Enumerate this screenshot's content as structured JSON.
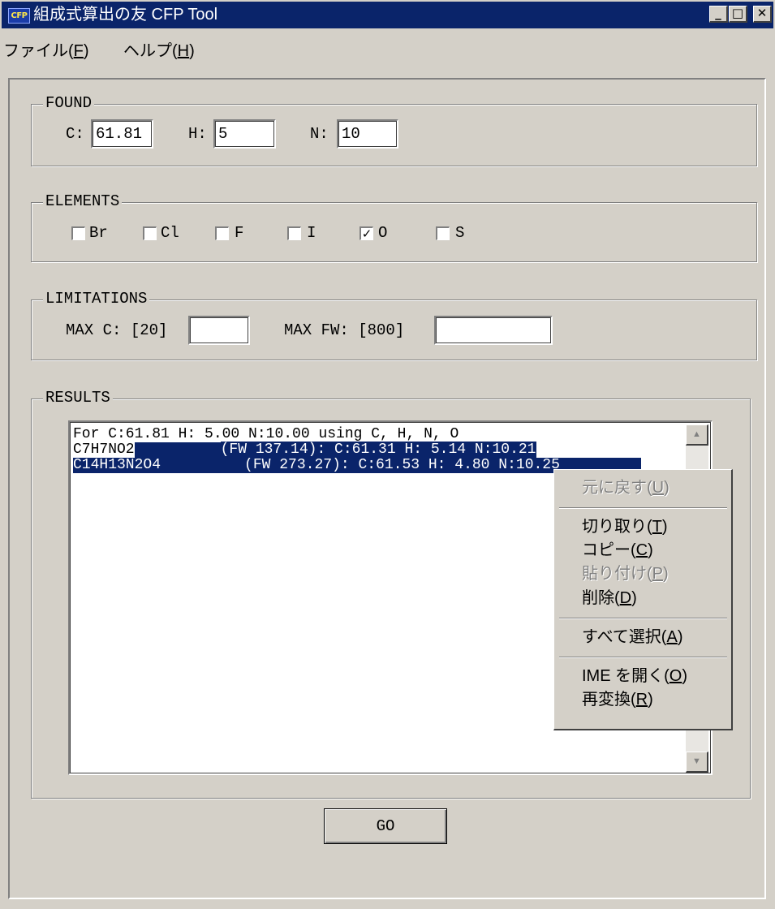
{
  "window": {
    "app_icon_text": "CFP",
    "title": "組成式算出の友  CFP Tool",
    "buttons": {
      "minimize": "_",
      "maximize": "□",
      "close": "✕"
    }
  },
  "menu": {
    "file": {
      "label": "ファイル(",
      "key": "F",
      "close": ")"
    },
    "help": {
      "label": "ヘルプ(",
      "key": "H",
      "close": ")"
    }
  },
  "found": {
    "legend": "FOUND",
    "c_label": "C:",
    "c_value": "61.81",
    "h_label": "H:",
    "h_value": "5",
    "n_label": "N:",
    "n_value": "10"
  },
  "elements": {
    "legend": "ELEMENTS",
    "items": [
      {
        "label": "Br",
        "checked": false
      },
      {
        "label": "Cl",
        "checked": false
      },
      {
        "label": "F",
        "checked": false
      },
      {
        "label": "I",
        "checked": false
      },
      {
        "label": "O",
        "checked": true
      },
      {
        "label": "S",
        "checked": false
      }
    ]
  },
  "limitations": {
    "legend": "LIMITATIONS",
    "max_c_label": "MAX C: [20]",
    "max_c_value": "",
    "max_fw_label": "MAX FW: [800]",
    "max_fw_value": ""
  },
  "results": {
    "legend": "RESULTS",
    "header": "For C:61.81 H: 5.00 N:10.00 using C, H, N, O",
    "rows": [
      {
        "formula": "C7H7NO2",
        "detail": "(FW 137.14): C:61.31 H: 5.14 N:10.21"
      },
      {
        "formula": "C14H13N2O4",
        "detail": "(FW 273.27): C:61.53 H: 4.80 N:10.25"
      }
    ]
  },
  "context_menu": {
    "undo": {
      "label": "元に戻す(",
      "key": "U",
      "close": ")"
    },
    "cut": {
      "label": "切り取り(",
      "key": "T",
      "close": ")"
    },
    "copy": {
      "label": "コピー(",
      "key": "C",
      "close": ")"
    },
    "paste": {
      "label": "貼り付け(",
      "key": "P",
      "close": ")"
    },
    "delete": {
      "label": "削除(",
      "key": "D",
      "close": ")"
    },
    "select_all": {
      "label": "すべて選択(",
      "key": "A",
      "close": ")"
    },
    "ime_open": {
      "label": "IME を開く(",
      "key": "O",
      "close": ")"
    },
    "reconvert": {
      "label": "再変換(",
      "key": "R",
      "close": ")"
    }
  },
  "go_button": "GO",
  "colors": {
    "face": "#d4d0c8",
    "titlebar": "#0a246a",
    "selection": "#0a246a"
  }
}
